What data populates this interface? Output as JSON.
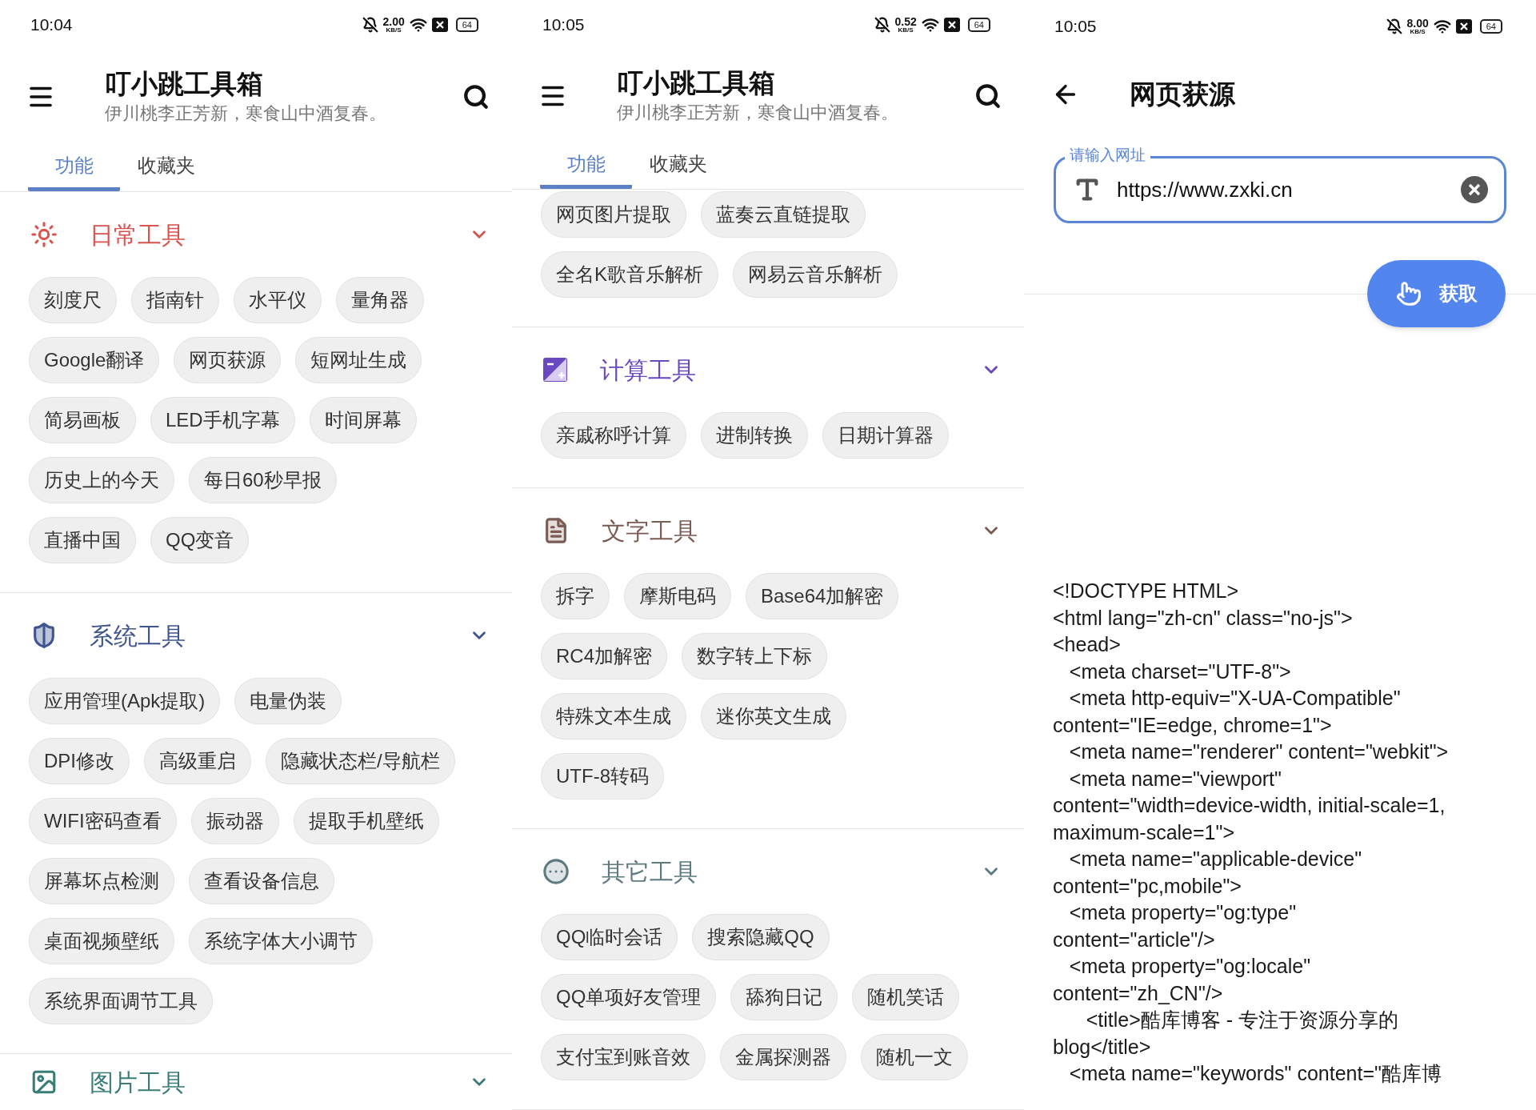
{
  "screens": [
    {
      "kind": "home",
      "status_bar": {
        "time": "10:04",
        "speed": "2.00",
        "speed_unit": "KB/S",
        "battery": "64"
      },
      "app_bar": {
        "title": "叮小跳工具箱",
        "subtitle": "伊川桃李正芳新，寒食山中酒复春。"
      },
      "tabs": [
        {
          "label": "功能",
          "selected": true
        },
        {
          "label": "收藏夹",
          "selected": false
        }
      ],
      "sections": [
        {
          "kind": "daily",
          "title": "日常工具",
          "color": "#d9534f",
          "rows": [
            [
              "刻度尺",
              "指南针",
              "水平仪",
              "量角器"
            ],
            [
              "Google翻译",
              "网页获源",
              "短网址生成"
            ],
            [
              "简易画板",
              "LED手机字幕",
              "时间屏幕"
            ],
            [
              "历史上的今天",
              "每日60秒早报"
            ],
            [
              "直播中国",
              "QQ变音"
            ]
          ]
        },
        {
          "kind": "system",
          "title": "系统工具",
          "color": "#3f5590",
          "rows": [
            [
              "应用管理(Apk提取)",
              "电量伪装"
            ],
            [
              "DPI修改",
              "高级重启",
              "隐藏状态栏/导航栏"
            ],
            [
              "WIFI密码查看",
              "振动器",
              "提取手机壁纸"
            ],
            [
              "屏幕坏点检测",
              "查看设备信息"
            ],
            [
              "桌面视频壁纸",
              "系统字体大小调节"
            ],
            [
              "系统界面调节工具"
            ]
          ]
        },
        {
          "kind": "image",
          "title": "图片工具",
          "color": "#3a7d78"
        }
      ]
    },
    {
      "kind": "home",
      "status_bar": {
        "time": "10:05",
        "speed": "0.52",
        "speed_unit": "KB/S",
        "battery": "64"
      },
      "app_bar": {
        "title": "叮小跳工具箱",
        "subtitle": "伊川桃李正芳新，寒食山中酒复春。"
      },
      "tabs": [
        {
          "label": "功能",
          "selected": true
        },
        {
          "label": "收藏夹",
          "selected": false
        }
      ],
      "leading_rows": [
        [
          "网页图片提取",
          "蓝奏云直链提取"
        ],
        [
          "全名K歌音乐解析",
          "网易云音乐解析"
        ]
      ],
      "sections": [
        {
          "kind": "calc",
          "title": "计算工具",
          "color": "#6a48c0",
          "rows": [
            [
              "亲戚称呼计算",
              "进制转换",
              "日期计算器"
            ]
          ]
        },
        {
          "kind": "text",
          "title": "文字工具",
          "color": "#7a5c55",
          "rows": [
            [
              "拆字",
              "摩斯电码",
              "Base64加解密"
            ],
            [
              "RC4加解密",
              "数字转上下标"
            ],
            [
              "特殊文本生成",
              "迷你英文生成"
            ],
            [
              "UTF-8转码"
            ]
          ]
        },
        {
          "kind": "other",
          "title": "其它工具",
          "color": "#5d7a80",
          "rows": [
            [
              "QQ临时会话",
              "搜索隐藏QQ"
            ],
            [
              "QQ单项好友管理",
              "舔狗日记",
              "随机笑话"
            ],
            [
              "支付宝到账音效",
              "金属探测器",
              "随机一文"
            ]
          ]
        }
      ]
    },
    {
      "kind": "source",
      "status_bar": {
        "time": "10:05",
        "speed": "8.00",
        "speed_unit": "KB/S",
        "battery": "64"
      },
      "title": "网页获源",
      "url_field": {
        "label": "请输入网址",
        "value": "https://www.zxki.cn"
      },
      "fetch_button": "获取",
      "source_lines": [
        "<!DOCTYPE HTML>",
        "<html lang=\"zh-cn\" class=\"no-js\">",
        "<head>",
        "   <meta charset=\"UTF-8\">",
        "   <meta http-equiv=\"X-UA-Compatible\"",
        "content=\"IE=edge, chrome=1\">",
        "   <meta name=\"renderer\" content=\"webkit\">",
        "   <meta name=\"viewport\"",
        "content=\"width=device-width, initial-scale=1,",
        "maximum-scale=1\">",
        "   <meta name=\"applicable-device\"",
        "content=\"pc,mobile\">",
        "   <meta property=\"og:type\"",
        "content=\"article\"/>",
        "   <meta property=\"og:locale\"",
        "content=\"zh_CN\"/>",
        "      <title>酷库博客 - 专注于资源分享的",
        "blog</title>",
        "   <meta name=\"keywords\" content=\"酷库博"
      ]
    }
  ]
}
